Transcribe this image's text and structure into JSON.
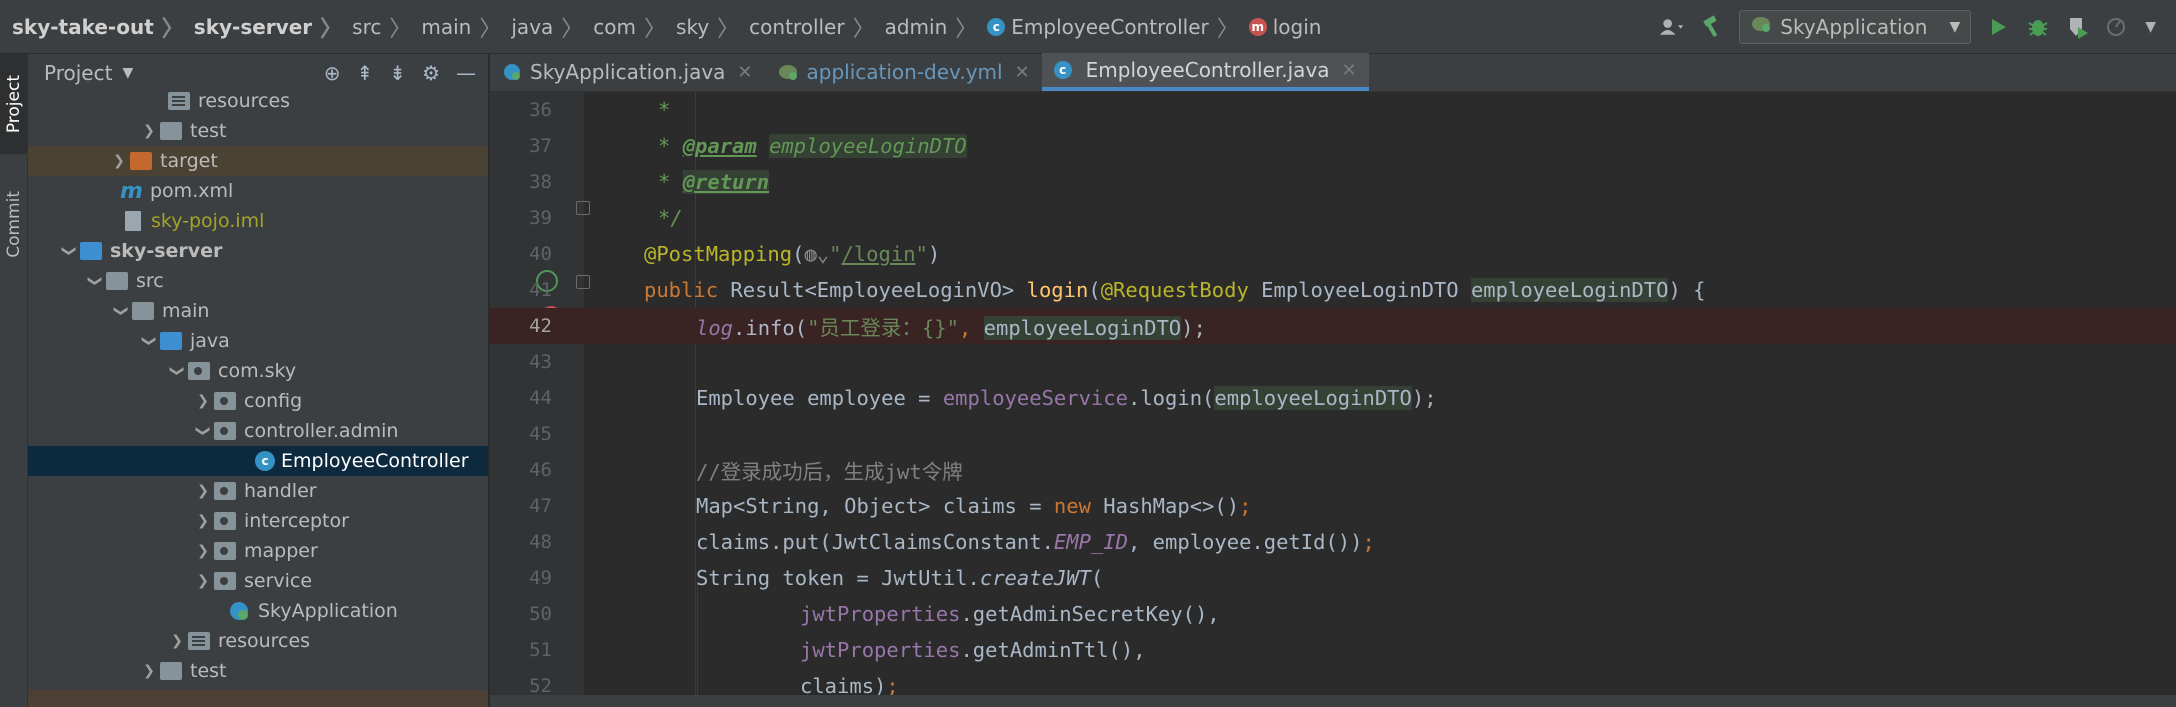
{
  "navbar": {
    "crumbs": [
      "sky-take-out",
      "sky-server",
      "src",
      "main",
      "java",
      "com",
      "sky",
      "controller",
      "admin",
      "EmployeeController",
      "login"
    ],
    "class_icon_letter": "c",
    "method_icon_letter": "m",
    "run_config": "SkyApplication"
  },
  "left_strip": {
    "project_tab": "Project",
    "commit_tab": "Commit"
  },
  "project_panel": {
    "title": "Project",
    "tree": [
      {
        "label": "resources",
        "kind": "res",
        "expanded": null
      },
      {
        "label": "test",
        "kind": "folder",
        "expanded": false
      },
      {
        "label": "target",
        "kind": "folder-orange",
        "expanded": false
      },
      {
        "label": "pom.xml",
        "kind": "maven",
        "expanded": null
      },
      {
        "label": "sky-pojo.iml",
        "kind": "iml",
        "expanded": null
      },
      {
        "label": "sky-server",
        "kind": "module",
        "expanded": true
      },
      {
        "label": "src",
        "kind": "folder",
        "expanded": true
      },
      {
        "label": "main",
        "kind": "folder",
        "expanded": true
      },
      {
        "label": "java",
        "kind": "folder-blue",
        "expanded": true
      },
      {
        "label": "com.sky",
        "kind": "pkg",
        "expanded": true
      },
      {
        "label": "config",
        "kind": "pkg",
        "expanded": false
      },
      {
        "label": "controller.admin",
        "kind": "pkg",
        "expanded": true
      },
      {
        "label": "EmployeeController",
        "kind": "class",
        "expanded": null
      },
      {
        "label": "handler",
        "kind": "pkg",
        "expanded": false
      },
      {
        "label": "interceptor",
        "kind": "pkg",
        "expanded": false
      },
      {
        "label": "mapper",
        "kind": "pkg",
        "expanded": false
      },
      {
        "label": "service",
        "kind": "pkg",
        "expanded": false
      },
      {
        "label": "SkyApplication",
        "kind": "springclass",
        "expanded": null
      },
      {
        "label": "resources",
        "kind": "res",
        "expanded": false
      },
      {
        "label": "test",
        "kind": "folder",
        "expanded": false
      }
    ]
  },
  "editor": {
    "tabs": [
      {
        "label": "SkyApplication.java",
        "active": false
      },
      {
        "label": "application-dev.yml",
        "active": false
      },
      {
        "label": "EmployeeController.java",
        "active": true
      }
    ],
    "line_numbers": [
      "36",
      "37",
      "38",
      "39",
      "40",
      "41",
      "42",
      "43",
      "44",
      "45",
      "46",
      "47",
      "48",
      "49",
      "50",
      "51",
      "52"
    ],
    "code": {
      "l36": "*",
      "l37_star": "* ",
      "l37_tag": "@param",
      "l37_name": "employeeLoginDTO",
      "l38_star": "* ",
      "l38_tag": "@return",
      "l39": "*/",
      "l40_ann": "@PostMapping",
      "l40_open": "(",
      "l40_str_q1": "\"",
      "l40_str_link": "/login",
      "l40_str_q2": "\"",
      "l40_close": ")",
      "l41_kw": "public",
      "l41_type": " Result<EmployeeLoginVO> ",
      "l41_meth": "login",
      "l41_open": "(",
      "l41_ann": "@RequestBody",
      "l41_ptype": " EmployeeLoginDTO ",
      "l41_param": "employeeLoginDTO",
      "l41_close": ") {",
      "l42_log": "log",
      "l42_info": ".info(",
      "l42_str": "\"员工登录：{}\"",
      "l42_comma": ", ",
      "l42_param": "employeeLoginDTO",
      "l42_end": ");",
      "l44_a": "Employee employee = ",
      "l44_svc": "employeeService",
      "l44_b": ".login(",
      "l44_param": "employeeLoginDTO",
      "l44_end": ");",
      "l46": "//登录成功后，生成jwt令牌",
      "l47_a": "Map<String, Object> claims = ",
      "l47_new": "new",
      "l47_b": " HashMap<>()",
      "l47_semi": ";",
      "l48_a": "claims.put(JwtClaimsConstant.",
      "l48_const": "EMP_ID",
      "l48_b": ", employee.getId())",
      "l48_semi": ";",
      "l49_a": "String token = JwtUtil.",
      "l49_stat": "createJWT",
      "l49_b": "(",
      "l50_fld": "jwtProperties",
      "l50_b": ".getAdminSecretKey(),",
      "l51_fld": "jwtProperties",
      "l51_b": ".getAdminTtl(),",
      "l52_a": "claims)",
      "l52_semi": ";"
    }
  },
  "colors": {
    "accent": "#4a88c7",
    "breakpoint": "#c75450",
    "selection": "#0d293e"
  }
}
